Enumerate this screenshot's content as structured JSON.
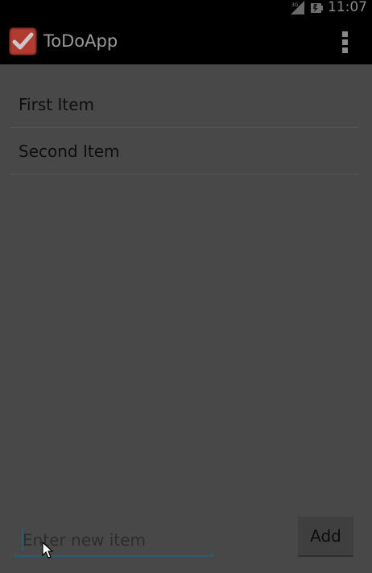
{
  "status_bar": {
    "network_icon": "signal-3g-icon",
    "battery_icon": "battery-icon",
    "time": "11:07"
  },
  "action_bar": {
    "app_icon": "checkmark-app-icon",
    "title": "ToDoApp",
    "overflow_icon": "overflow-menu-icon"
  },
  "list": {
    "items": [
      {
        "label": "First Item"
      },
      {
        "label": "Second Item"
      }
    ]
  },
  "composer": {
    "input_value": "",
    "input_placeholder": "Enter new item",
    "add_label": "Add"
  },
  "colors": {
    "accent": "#2a5c70",
    "app_icon_red": "#d9473a",
    "background": "#484848"
  }
}
